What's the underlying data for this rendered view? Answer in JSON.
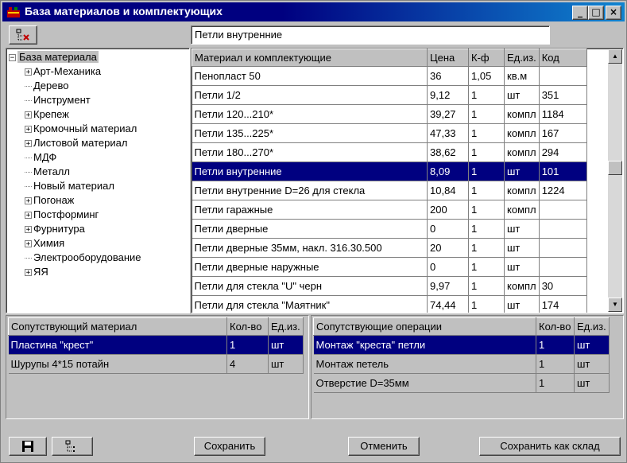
{
  "window": {
    "title": "База материалов и комплектующих",
    "minimize": "_",
    "maximize": "□",
    "close": "×"
  },
  "search": {
    "value": "Петли внутренние"
  },
  "tree": {
    "root": "База материала",
    "items": [
      {
        "label": "Арт-Механика",
        "expandable": true
      },
      {
        "label": "Дерево",
        "expandable": false
      },
      {
        "label": "Инструмент",
        "expandable": false
      },
      {
        "label": "Крепеж",
        "expandable": true
      },
      {
        "label": "Кромочный материал",
        "expandable": true
      },
      {
        "label": "Листовой материал",
        "expandable": true
      },
      {
        "label": "МДФ",
        "expandable": false
      },
      {
        "label": "Металл",
        "expandable": false
      },
      {
        "label": "Новый материал",
        "expandable": false
      },
      {
        "label": "Погонаж",
        "expandable": true
      },
      {
        "label": "Постформинг",
        "expandable": true
      },
      {
        "label": "Фурнитура",
        "expandable": true
      },
      {
        "label": "Химия",
        "expandable": true
      },
      {
        "label": "Электрооборудование",
        "expandable": false
      },
      {
        "label": "ЯЯ",
        "expandable": true
      }
    ]
  },
  "materials": {
    "headers": [
      "Материал и комплектующие",
      "Цена",
      "К-ф",
      "Ед.из.",
      "Код"
    ],
    "rows": [
      [
        "Пенопласт 50",
        "36",
        "1,05",
        "кв.м",
        ""
      ],
      [
        "Петли 1/2",
        "9,12",
        "1",
        "шт",
        "351"
      ],
      [
        "Петли 120...210*",
        "39,27",
        "1",
        "компл",
        "1184"
      ],
      [
        "Петли 135...225*",
        "47,33",
        "1",
        "компл",
        "167"
      ],
      [
        "Петли 180...270*",
        "38,62",
        "1",
        "компл",
        "294"
      ],
      [
        "Петли внутренние",
        "8,09",
        "1",
        "шт",
        "101"
      ],
      [
        "Петли внутренние D=26 для стекла",
        "10,84",
        "1",
        "компл",
        "1224"
      ],
      [
        "Петли гаражные",
        "200",
        "1",
        "компл",
        ""
      ],
      [
        "Петли дверные",
        "0",
        "1",
        "шт",
        ""
      ],
      [
        "Петли дверные 35мм,  накл.  316.30.500",
        "20",
        "1",
        "шт",
        ""
      ],
      [
        "Петли дверные наружные",
        "0",
        "1",
        "шт",
        ""
      ],
      [
        "Петли для стекла \"U\" черн",
        "9,97",
        "1",
        "компл",
        "30"
      ],
      [
        "Петли для стекла \"Маятник\"",
        "74,44",
        "1",
        "шт",
        "174"
      ]
    ],
    "selected_row": 5
  },
  "related_materials": {
    "headers": [
      "Сопутствующий материал",
      "Кол-во",
      "Ед.из."
    ],
    "rows": [
      [
        "Пластина \"крест\"",
        "1",
        "шт"
      ],
      [
        "Шурупы 4*15 потайн",
        "4",
        "шт"
      ]
    ]
  },
  "related_operations": {
    "headers": [
      "Сопутствующие операции",
      "Кол-во",
      "Ед.из."
    ],
    "rows": [
      [
        "Монтаж \"креста\" петли",
        "1",
        "шт"
      ],
      [
        "Монтаж петель",
        "1",
        "шт"
      ],
      [
        "Отверстие D=35мм",
        "1",
        "шт"
      ]
    ]
  },
  "buttons": {
    "save": "Сохранить",
    "cancel": "Отменить",
    "save_as_warehouse": "Сохранить как склад"
  },
  "icons": {
    "toolbar_tree": "tree-delete-icon",
    "disk": "floppy-disk-icon",
    "tree": "tree-icon"
  }
}
